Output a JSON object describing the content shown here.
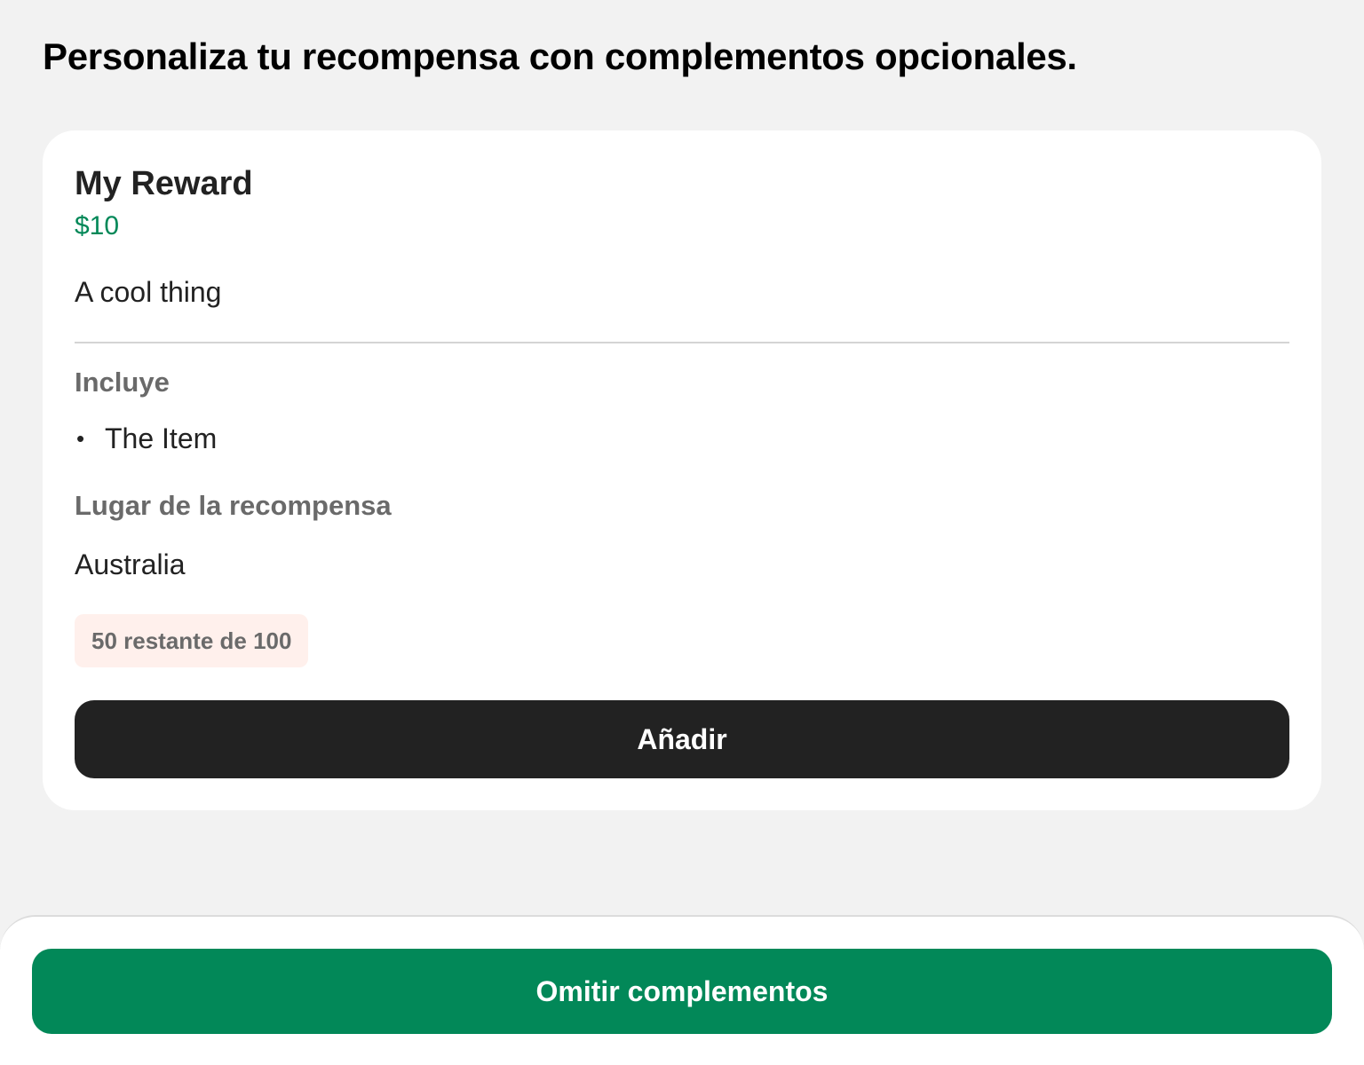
{
  "page": {
    "heading": "Personaliza tu recompensa con complementos opcionales."
  },
  "reward": {
    "title": "My Reward",
    "price": "$10",
    "description": "A cool thing",
    "includes_label": "Incluye",
    "includes": [
      {
        "bullet": "•",
        "label": "The Item"
      }
    ],
    "location_label": "Lugar de la recompensa",
    "location_value": "Australia",
    "remaining_text": "50 restante de 100",
    "add_button_label": "Añadir"
  },
  "footer": {
    "skip_button_label": "Omitir complementos"
  },
  "colors": {
    "background": "#f2f2f2",
    "card": "#ffffff",
    "price_green": "#028858",
    "primary_button": "#222222",
    "skip_button": "#028858",
    "badge_background": "#fff0ec",
    "muted_text": "#6a6a6a"
  }
}
